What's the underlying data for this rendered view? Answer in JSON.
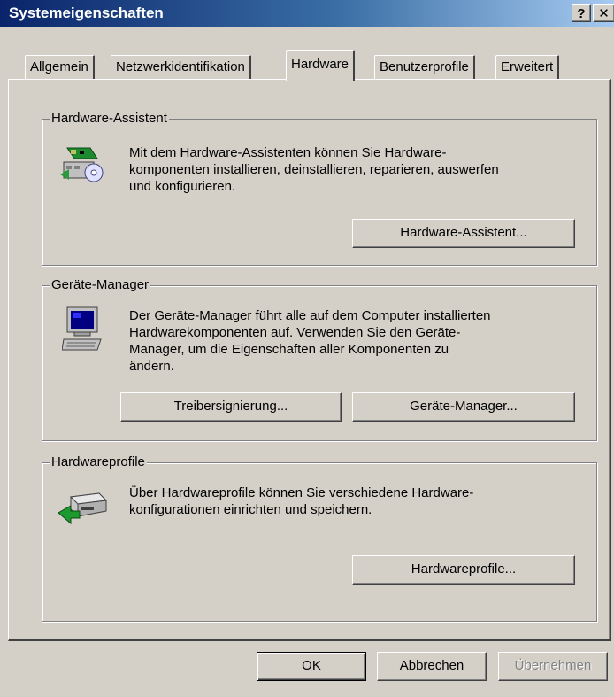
{
  "window": {
    "title": "Systemeigenschaften",
    "help_label": "?",
    "close_label": "✕"
  },
  "tabs": [
    {
      "label": "Allgemein",
      "active": false
    },
    {
      "label": "Netzwerkidentifikation",
      "active": false
    },
    {
      "label": "Hardware",
      "active": true
    },
    {
      "label": "Benutzerprofile",
      "active": false
    },
    {
      "label": "Erweitert",
      "active": false
    }
  ],
  "groups": {
    "assistant": {
      "title": "Hardware-Assistent",
      "lines": [
        "Mit dem Hardware-Assistenten können Sie Hardware-",
        "komponenten installieren, deinstallieren, reparieren, auswerfen",
        "und konfigurieren."
      ],
      "button": "Hardware-Assistent...",
      "icon": "hardware-wizard-icon"
    },
    "device_manager": {
      "title": "Geräte-Manager",
      "lines": [
        "Der Geräte-Manager führt alle auf dem Computer installierten",
        "Hardwarekomponenten auf. Verwenden Sie den Geräte-",
        "Manager, um die Eigenschaften aller Komponenten zu",
        "ändern."
      ],
      "button_signing": "Treibersignierung...",
      "button_manager": "Geräte-Manager...",
      "icon": "computer-icon"
    },
    "profiles": {
      "title": "Hardwareprofile",
      "lines": [
        "Über Hardwareprofile können Sie verschiedene Hardware-",
        "konfigurationen einrichten und speichern."
      ],
      "button": "Hardwareprofile...",
      "icon": "hardware-profile-icon"
    }
  },
  "footer": {
    "ok": "OK",
    "cancel": "Abbrechen",
    "apply": "Übernehmen",
    "apply_enabled": false
  }
}
